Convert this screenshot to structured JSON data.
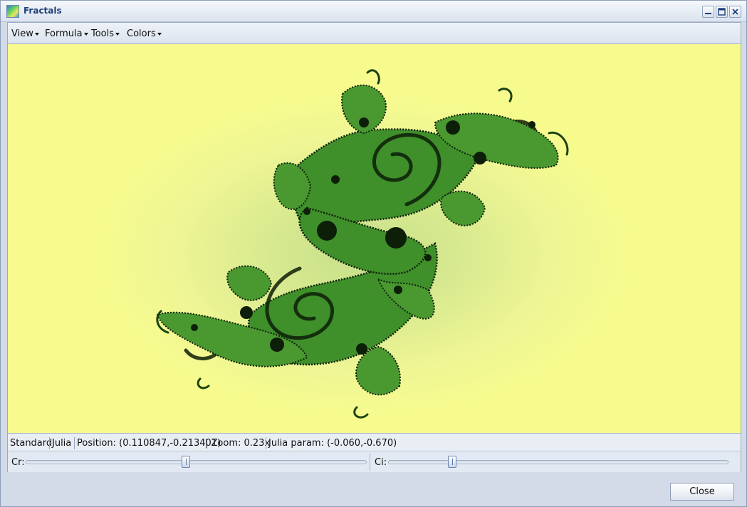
{
  "window": {
    "title": "Fractals",
    "app_icon": "fractal-app-icon",
    "controls": [
      "minimize-icon",
      "maximize-icon",
      "close-icon"
    ]
  },
  "menubar": {
    "items": [
      {
        "label": "View"
      },
      {
        "label": "Formula"
      },
      {
        "label": "Tools"
      },
      {
        "label": "Colors"
      }
    ]
  },
  "fractal": {
    "kind": "Julia set",
    "colors": {
      "background": "#f7fb8e",
      "inner_glow": "#c6df8a",
      "fractal": "#3f8f2a",
      "dark": "#0d1f08"
    }
  },
  "status": {
    "mode": "Standard",
    "formula": "Julia",
    "position": "Position: (0.110847,-0.213401)",
    "zoom": "| Zoom: 0.23x",
    "julia_param": "Julia param: (-0.060,-0.670)"
  },
  "sliders": {
    "cr": {
      "label": "Cr:",
      "position": 0.47
    },
    "ci": {
      "label": "Ci:",
      "position": 0.18
    }
  },
  "footer": {
    "close_label": "Close"
  }
}
